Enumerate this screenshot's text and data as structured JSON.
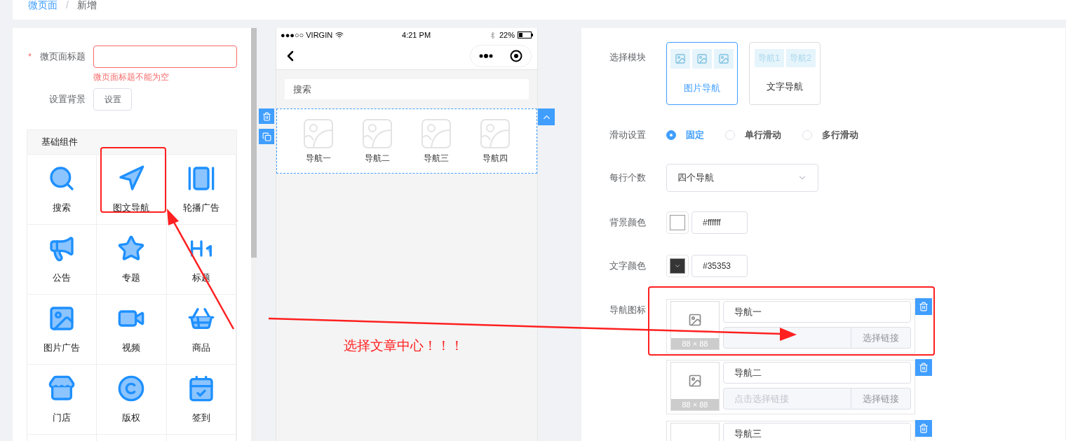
{
  "breadcrumb": {
    "items": [
      "微页面",
      "新增"
    ],
    "separator": "/"
  },
  "page_form": {
    "title_field": {
      "label": "微页面标题",
      "required_mark": "*",
      "error": "微页面标题不能为空"
    },
    "background": {
      "label": "设置背景",
      "button": "设置"
    }
  },
  "components": {
    "header": "基础组件",
    "items": [
      {
        "label": "搜索"
      },
      {
        "label": "图文导航"
      },
      {
        "label": "轮播广告"
      },
      {
        "label": "公告"
      },
      {
        "label": "专题"
      },
      {
        "label": "标题"
      },
      {
        "label": "图片广告"
      },
      {
        "label": "视频"
      },
      {
        "label": "商品"
      },
      {
        "label": "门店"
      },
      {
        "label": "版权"
      },
      {
        "label": "签到"
      }
    ]
  },
  "phone": {
    "status": {
      "carrier": "●●●○○ VIRGIN",
      "time": "4:21 PM",
      "battery": "22%"
    },
    "search_placeholder": "搜索",
    "nav_items": [
      "导航一",
      "导航二",
      "导航三",
      "导航四"
    ]
  },
  "settings": {
    "module": {
      "label": "选择模块",
      "options": [
        {
          "kind": "image",
          "label": "图片导航",
          "selected": true
        },
        {
          "kind": "text",
          "label": "文字导航",
          "selected": false,
          "preview": [
            "导航1",
            "导航2"
          ]
        }
      ]
    },
    "scroll": {
      "label": "滑动设置",
      "options": [
        {
          "label": "固定",
          "selected": true
        },
        {
          "label": "单行滑动",
          "selected": false
        },
        {
          "label": "多行滑动",
          "selected": false
        }
      ]
    },
    "per_row": {
      "label": "每行个数",
      "value": "四个导航"
    },
    "color_rows": [
      {
        "label": "背景颜色",
        "color": "#ffffff",
        "value": "#ffffff"
      },
      {
        "label": "文字颜色",
        "color": "#353535",
        "value": "#35353"
      }
    ],
    "nav_icons": {
      "label": "导航图标",
      "items": [
        {
          "name": "导航一",
          "image_size": "88 × 88",
          "link_button": "选择链接"
        },
        {
          "name": "导航二",
          "image_size": "88 × 88",
          "link_placeholder": "点击选择链接",
          "link_button": "选择链接"
        },
        {
          "name": "导航三"
        }
      ]
    }
  },
  "annotation": {
    "note": "选择文章中心！！！"
  }
}
